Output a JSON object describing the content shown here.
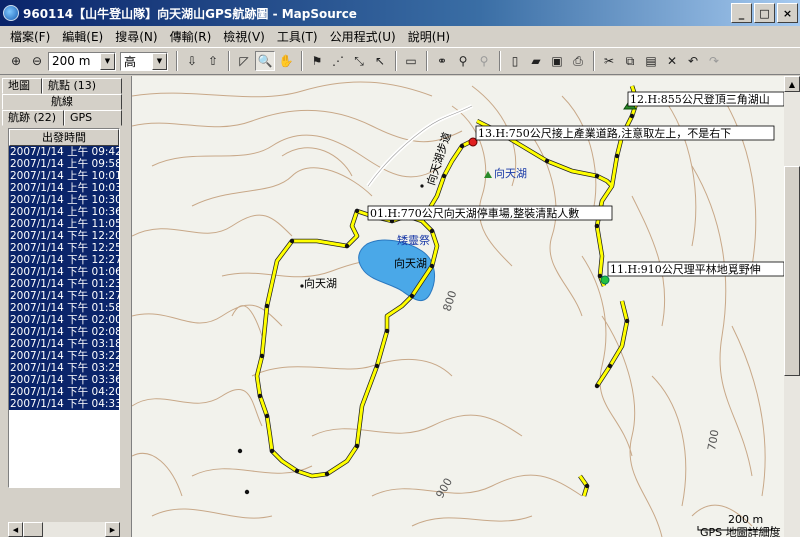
{
  "window": {
    "title": "960114【山牛登山隊】向天湖山GPS航跡圖 - MapSource",
    "minimize": "_",
    "maximize": "□",
    "close": "×"
  },
  "menu": [
    "檔案(F)",
    "編輯(E)",
    "搜尋(N)",
    "傳輸(R)",
    "檢視(V)",
    "工具(T)",
    "公用程式(U)",
    "說明(H)"
  ],
  "toolbar": {
    "zoom_value": "200 m",
    "detail_value": "高"
  },
  "left_panel": {
    "tabs_row1": [
      "地圖",
      "航點 (13)"
    ],
    "tabs_row2": [
      "航線"
    ],
    "tabs_row3": [
      "航跡 (22)",
      "GPS"
    ],
    "column_header": "出發時間",
    "rows": [
      "2007/1/14 上午 09:42",
      "2007/1/14 上午 09:58",
      "2007/1/14 上午 10:01",
      "2007/1/14 上午 10:03",
      "2007/1/14 上午 10:30",
      "2007/1/14 上午 10:36",
      "2007/1/14 上午 11:05",
      "2007/1/14 下午 12:20",
      "2007/1/14 下午 12:25",
      "2007/1/14 下午 12:27",
      "2007/1/14 下午 01:06",
      "2007/1/14 下午 01:23",
      "2007/1/14 下午 01:27",
      "2007/1/14 下午 01:58",
      "2007/1/14 下午 02:00",
      "2007/1/14 下午 02:08",
      "2007/1/14 下午 03:18",
      "2007/1/14 下午 03:22",
      "2007/1/14 下午 03:25",
      "2007/1/14 下午 03:36",
      "2007/1/14 下午 04:20",
      "2007/1/14 下午 04:33"
    ]
  },
  "map": {
    "waypoints": [
      "12.H:855公尺登頂三角湖山",
      "13.H:750公尺接上產業道路,注意取左上，不是右下",
      "01.H:770公尺向天湖停車場,整裝清點人數",
      "11.H:910公尺理平林地覓野伸"
    ],
    "labels": {
      "lake": "向天湖",
      "lake_place": "向天湖",
      "poi": "向天湖",
      "temple": "矮靈祭",
      "road": "向天湖步道",
      "contour_800": "800",
      "contour_900": "900",
      "contour_700": "700"
    },
    "scale": "200 m",
    "footer": "GPS 地圖詳細度"
  },
  "colors": {
    "track": "#ffff00",
    "lake": "#4aa8e8",
    "contour": "#c8a888"
  }
}
